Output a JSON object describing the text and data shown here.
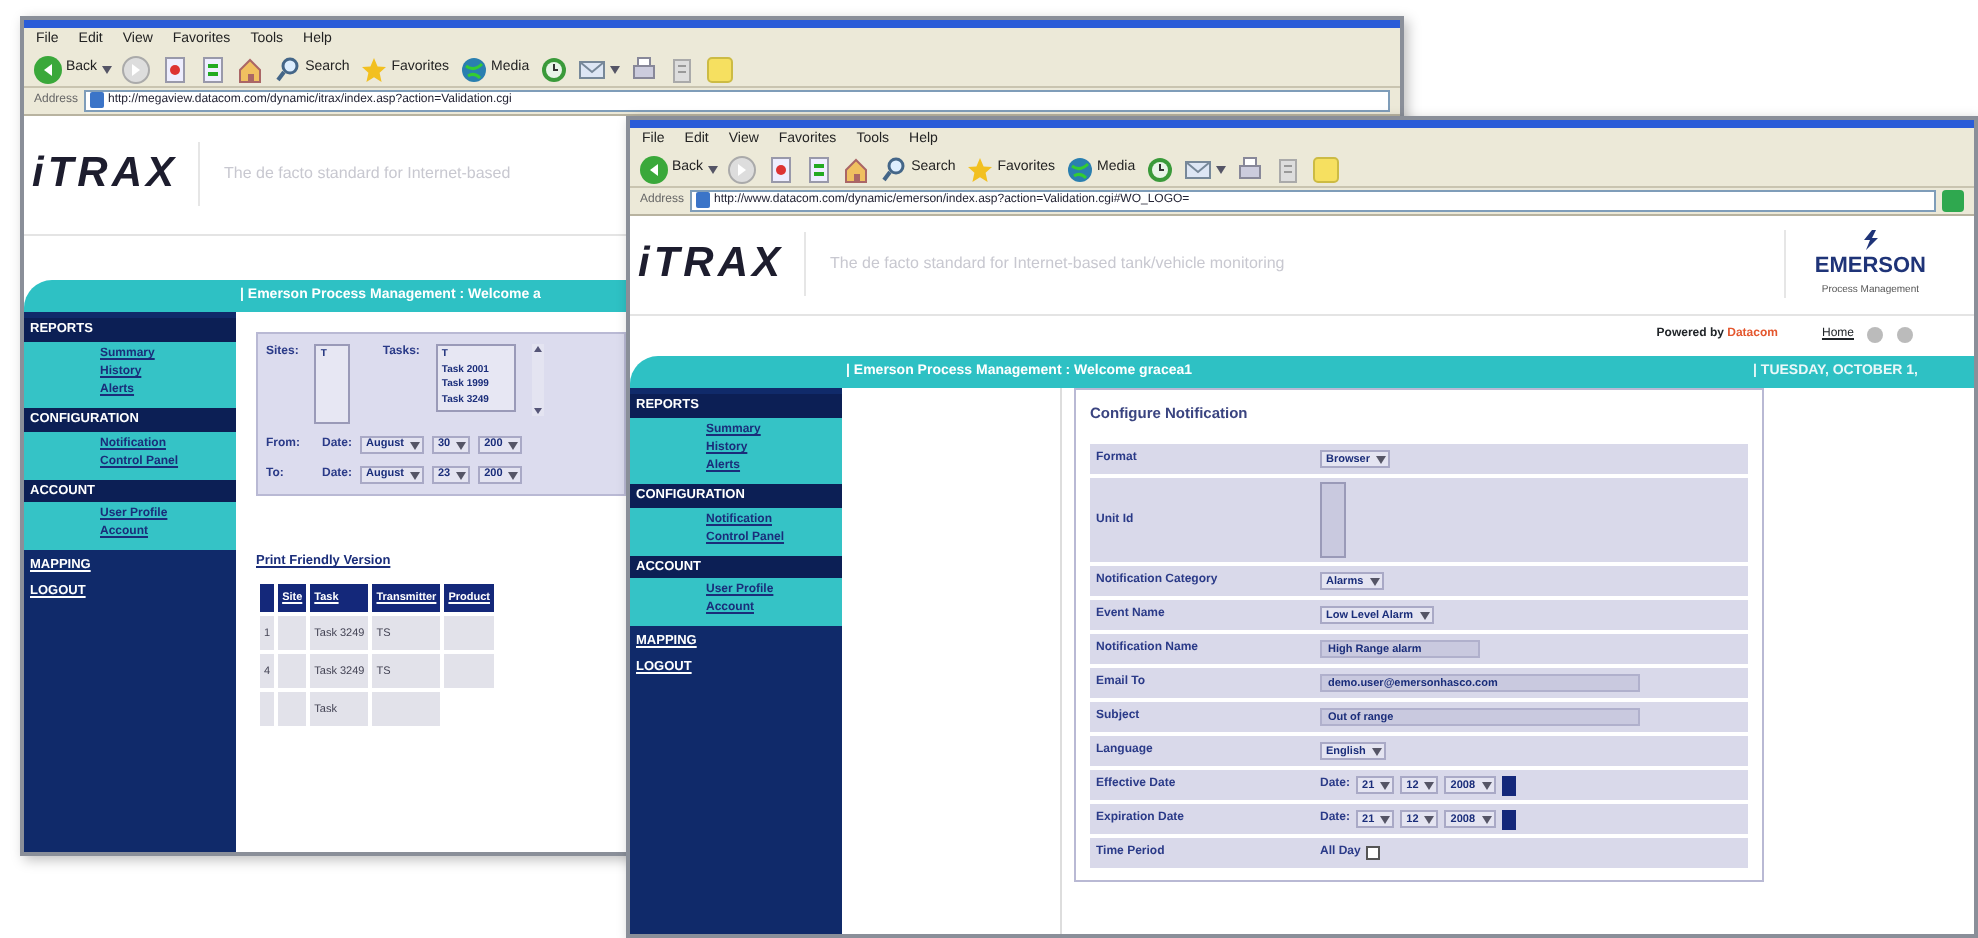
{
  "windows": [
    {
      "kind": "report",
      "menu": [
        "File",
        "Edit",
        "View",
        "Favorites",
        "Tools",
        "Help"
      ],
      "toolbar": [
        {
          "kind": "back",
          "label": "Back",
          "caret": true
        },
        {
          "kind": "forward"
        },
        {
          "kind": "stop"
        },
        {
          "kind": "refresh"
        },
        {
          "kind": "home"
        },
        {
          "kind": "search",
          "label": "Search"
        },
        {
          "kind": "favorites",
          "label": "Favorites"
        },
        {
          "kind": "media",
          "label": "Media"
        },
        {
          "kind": "history"
        },
        {
          "kind": "mail",
          "caret": true
        },
        {
          "kind": "print"
        },
        {
          "kind": "edit"
        },
        {
          "kind": "note"
        }
      ],
      "address_label": "Address",
      "url": "http://megaview.datacom.com/dynamic/itrax/index.asp?action=Validation.cgi",
      "logo": "iTRAX",
      "tagline": "The de facto standard for Internet-based",
      "banner": "| Emerson Process Management : Welcome a",
      "sidebar": [
        {
          "title": "REPORTS",
          "items": [
            "Summary",
            "History",
            "Alerts"
          ]
        },
        {
          "title": "CONFIGURATION",
          "items": [
            "Notification",
            "Control Panel"
          ]
        },
        {
          "title": "ACCOUNT",
          "items": [
            "User Profile",
            "Account"
          ]
        },
        {
          "title": "MAPPING"
        },
        {
          "title": "LOGOUT"
        }
      ],
      "filter": {
        "sites": {
          "label": "Sites:",
          "items": [
            "T"
          ]
        },
        "tasks": {
          "label": "Tasks:",
          "items": [
            "T",
            "Task 2001",
            "Task 1999",
            "Task 3249"
          ]
        },
        "ranges": [
          {
            "label": "From:",
            "prefix": "Date:",
            "parts": [
              "August",
              "30",
              "200"
            ]
          },
          {
            "label": "To:",
            "prefix": "Date:",
            "parts": [
              "August",
              "23",
              "200"
            ]
          }
        ]
      },
      "print_link": "Print Friendly Version",
      "table": {
        "columns": [
          "",
          "Site",
          "Task",
          "Transmitter",
          "Product"
        ],
        "rows": [
          [
            "1",
            "",
            "Task 3249",
            "TS",
            ""
          ],
          [
            "4",
            "",
            "Task 3249",
            "TS",
            ""
          ],
          [
            "",
            "",
            "Task",
            ""
          ]
        ]
      }
    },
    {
      "kind": "notification",
      "menu": [
        "File",
        "Edit",
        "View",
        "Favorites",
        "Tools",
        "Help"
      ],
      "toolbar": [
        {
          "kind": "back",
          "label": "Back",
          "caret": true
        },
        {
          "kind": "forward"
        },
        {
          "kind": "stop"
        },
        {
          "kind": "refresh"
        },
        {
          "kind": "home"
        },
        {
          "kind": "search",
          "label": "Search"
        },
        {
          "kind": "favorites",
          "label": "Favorites"
        },
        {
          "kind": "media",
          "label": "Media"
        },
        {
          "kind": "history"
        },
        {
          "kind": "mail",
          "caret": true
        },
        {
          "kind": "print"
        },
        {
          "kind": "edit"
        },
        {
          "kind": "note"
        }
      ],
      "address_label": "Address",
      "url": "http://www.datacom.com/dynamic/emerson/index.asp?action=Validation.cgi#WO_LOGO=",
      "go_button": true,
      "logo": "iTRAX",
      "tagline": "The de facto standard for Internet-based tank/vehicle monitoring",
      "brand": {
        "name": "EMERSON",
        "sub": "Process Management"
      },
      "powered": {
        "label": "Powered by",
        "company": "Datacom",
        "home": "Home"
      },
      "banner": "| Emerson Process Management : Welcome gracea1",
      "banner_date": "| TUESDAY, OCTOBER 1,",
      "sidebar": [
        {
          "title": "REPORTS",
          "items": [
            "Summary",
            "History",
            "Alerts"
          ]
        },
        {
          "title": "CONFIGURATION",
          "items": [
            "Notification",
            "Control Panel"
          ]
        },
        {
          "title": "ACCOUNT",
          "items": [
            "User Profile",
            "Account"
          ]
        },
        {
          "title": "MAPPING"
        },
        {
          "title": "LOGOUT"
        }
      ],
      "form": {
        "title": "Configure Notification",
        "rows": [
          {
            "label": "Format",
            "kind": "select",
            "value": "Browser"
          },
          {
            "label": "Unit Id",
            "kind": "listbox"
          },
          {
            "label": "Notification Category",
            "kind": "select",
            "value": "Alarms"
          },
          {
            "label": "Event Name",
            "kind": "select",
            "value": "Low Level Alarm"
          },
          {
            "label": "Notification Name",
            "kind": "text",
            "value": "High Range alarm"
          },
          {
            "label": "Email To",
            "kind": "text",
            "value": "demo.user@emersonhasco.com"
          },
          {
            "label": "Subject",
            "kind": "text",
            "value": "Out of range"
          },
          {
            "label": "Language",
            "kind": "select",
            "value": "English"
          },
          {
            "label": "Effective Date",
            "kind": "date",
            "prefix": "Date:",
            "parts": [
              "21",
              "12",
              "2008"
            ]
          },
          {
            "label": "Expiration Date",
            "kind": "date",
            "prefix": "Date:",
            "parts": [
              "21",
              "12",
              "2008"
            ]
          },
          {
            "label": "Time Period",
            "kind": "checkbox",
            "text": "All Day",
            "checked": false
          }
        ]
      }
    }
  ]
}
